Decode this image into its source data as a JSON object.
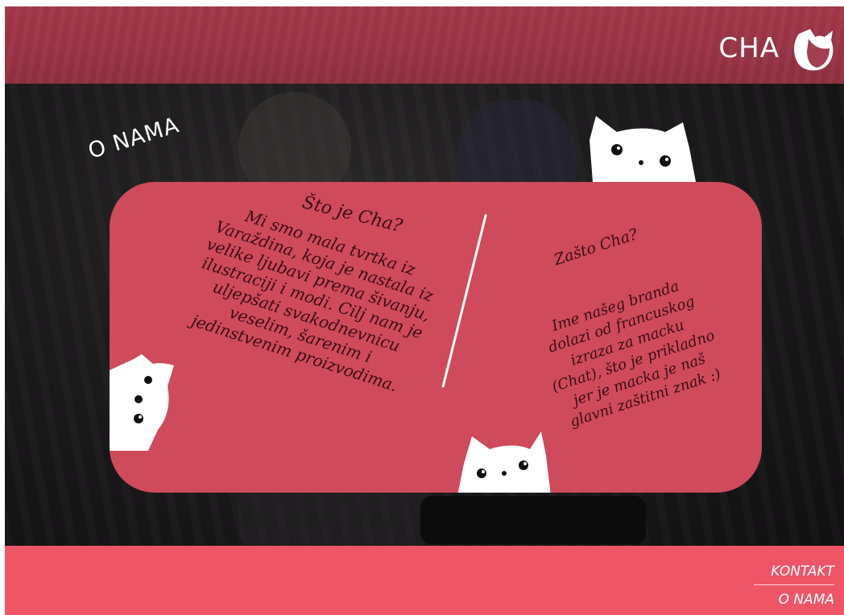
{
  "header": {
    "logo_text": "CHA",
    "logo_icon": "cat-logo-icon",
    "background_color": "#9d3547"
  },
  "main": {
    "section_title": "O NAMA",
    "card": {
      "background_color": "#cf4a5b",
      "left": {
        "title": "Što je Cha?",
        "lines": [
          "Mi smo mala tvrtka iz",
          "Varaždina, koja je nastala iz",
          "velike ljubavi prema šivanju,",
          "ilustraciji i modi. Cilj nam je",
          "uljepšati svakodnevnicu",
          "veselim, šarenim i",
          "jedinstvenim proizvodima."
        ]
      },
      "right": {
        "title": "Zašto Cha?",
        "lines": [
          "Ime našeg branda",
          "dolazi od francuskog",
          "izraza za macku",
          "(Chat), što je prikladno",
          "jer je macka je naš",
          "glavni zaštitni znak :)"
        ]
      }
    },
    "decor_icons": [
      "cat-peek-top-icon",
      "cat-peek-left-icon",
      "cat-peek-bottom-icon"
    ]
  },
  "footer": {
    "background_color": "#ee5567",
    "links": [
      "KONTAKT",
      "O NAMA"
    ]
  }
}
